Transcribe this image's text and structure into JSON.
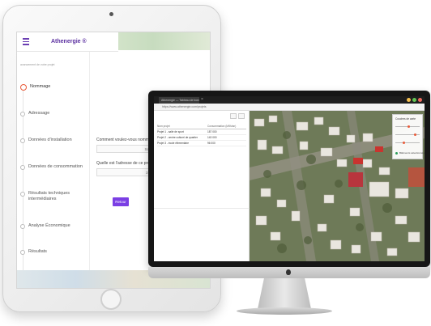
{
  "tablet_app": {
    "title": "Athenergie ®",
    "sidebar_caption": "avancement de votre projet",
    "steps": [
      {
        "label": "Nommage",
        "active": true
      },
      {
        "label": "Adressage",
        "active": false
      },
      {
        "label": "Données d'installation",
        "active": false
      },
      {
        "label": "Données de consommation",
        "active": false
      },
      {
        "label": "Résultats techniques intermédiaires",
        "active": false
      },
      {
        "label": "Analyse Économique",
        "active": false
      },
      {
        "label": "Résultats",
        "active": false
      }
    ],
    "form": {
      "question_name": "Comment voulez-vous nommer",
      "name_value": "Salle de sport, l",
      "question_address": "Quelle est l'adresse de ce proje",
      "address_value": "3 rue du maré",
      "back_button": "Retour"
    }
  },
  "desktop_app": {
    "window_tab": "Athenergie — Tableau de bord",
    "address_bar": "https://www.athenergie.com/projets",
    "table": {
      "headers": [
        "Nom projet",
        "Consommation (kWh/an)"
      ],
      "rows": [
        [
          "Projet 1 - salle de sport",
          "187 000"
        ],
        [
          "Projet 2 - centre culturel de quartier",
          "143 000"
        ],
        [
          "Projet 3 - école élémentaire",
          "96 000"
        ]
      ]
    },
    "overlay_panel": {
      "title": "Couches de carte",
      "legend_label": "Bâtiments sélectionnés"
    }
  },
  "colors": {
    "brand_purple": "#7b3fe4",
    "active_step": "#e85b3a"
  }
}
